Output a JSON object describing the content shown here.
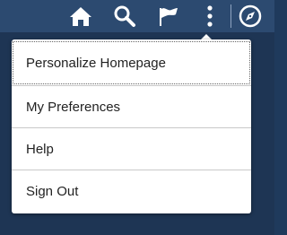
{
  "header": {
    "buttons": [
      {
        "name": "home",
        "icon": "home-icon"
      },
      {
        "name": "search",
        "icon": "search-icon"
      },
      {
        "name": "notifications",
        "icon": "flag-icon"
      },
      {
        "name": "actions",
        "icon": "vertical-ellipsis-icon"
      },
      {
        "name": "navbar",
        "icon": "compass-icon"
      }
    ]
  },
  "actions_menu": {
    "items": [
      {
        "label": "Personalize Homepage"
      },
      {
        "label": "My Preferences"
      },
      {
        "label": "Help"
      },
      {
        "label": "Sign Out"
      }
    ]
  },
  "colors": {
    "header_bg": "#2c4a70",
    "page_bg": "#1e3554",
    "icon": "#ffffff",
    "menu_bg": "#ffffff",
    "menu_text": "#222222",
    "divider": "#c9c9c9"
  }
}
